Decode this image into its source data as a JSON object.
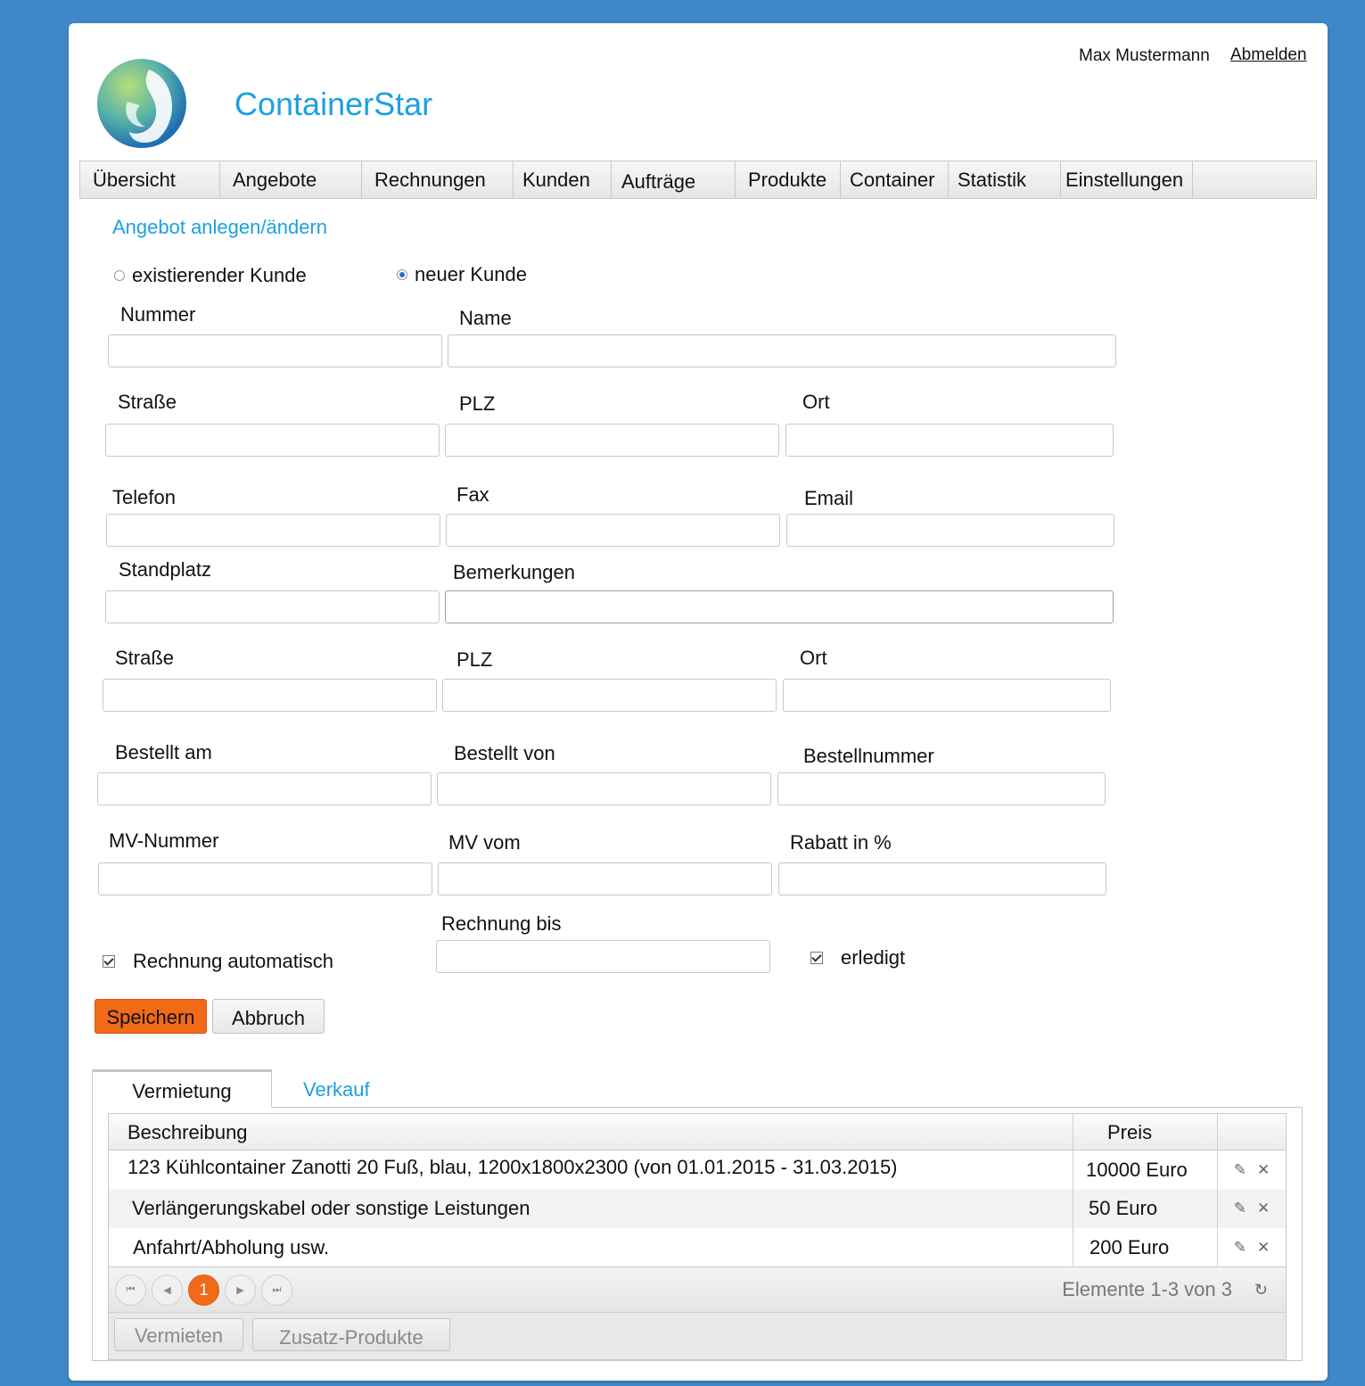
{
  "header": {
    "app_title": "ContainerStar",
    "user_name": "Max Mustermann",
    "logout_label": "Abmelden"
  },
  "nav": {
    "items": [
      {
        "label": "Übersicht"
      },
      {
        "label": "Angebote"
      },
      {
        "label": "Rechnungen"
      },
      {
        "label": "Kunden"
      },
      {
        "label": "Aufträge"
      },
      {
        "label": "Produkte"
      },
      {
        "label": "Container"
      },
      {
        "label": "Statistik"
      },
      {
        "label": "Einstellungen"
      }
    ]
  },
  "form": {
    "title": "Angebot anlegen/ändern",
    "customer_mode": {
      "existing_label": "existierender Kunde",
      "new_label": "neuer Kunde",
      "selected": "neuer Kunde"
    },
    "labels": {
      "nummer": "Nummer",
      "name": "Name",
      "strasse": "Straße",
      "plz": "PLZ",
      "ort": "Ort",
      "telefon": "Telefon",
      "fax": "Fax",
      "email": "Email",
      "standplatz": "Standplatz",
      "bemerkungen": "Bemerkungen",
      "strasse2": "Straße",
      "plz2": "PLZ",
      "ort2": "Ort",
      "bestellt_am": "Bestellt am",
      "bestellt_von": "Bestellt von",
      "bestellnummer": "Bestellnummer",
      "mv_nummer": "MV-Nummer",
      "mv_vom": "MV vom",
      "rabatt": "Rabatt in %",
      "rechnung_bis": "Rechnung bis"
    },
    "values": {
      "nummer": "",
      "name": "",
      "strasse": "",
      "plz": "",
      "ort": "",
      "telefon": "",
      "fax": "",
      "email": "",
      "standplatz": "",
      "bemerkungen": "",
      "strasse2": "",
      "plz2": "",
      "ort2": "",
      "bestellt_am": "",
      "bestellt_von": "",
      "bestellnummer": "",
      "mv_nummer": "",
      "mv_vom": "",
      "rabatt": "",
      "rechnung_bis": ""
    },
    "rechnung_automatisch": {
      "label": "Rechnung automatisch",
      "checked": true
    },
    "erledigt": {
      "label": "erledigt",
      "checked": true
    },
    "save_label": "Speichern",
    "cancel_label": "Abbruch"
  },
  "tabs": {
    "items": [
      {
        "label": "Vermietung",
        "active": true
      },
      {
        "label": "Verkauf",
        "active": false
      }
    ]
  },
  "grid": {
    "columns": [
      "Beschreibung",
      "Preis",
      ""
    ],
    "rows": [
      {
        "beschreibung": "123 Kühlcontainer Zanotti 20 Fuß, blau, 1200x1800x2300 (von 01.01.2015 - 31.03.2015)",
        "preis": "10000 Euro"
      },
      {
        "beschreibung": "Verlängerungskabel oder sonstige Leistungen",
        "preis": "50 Euro"
      },
      {
        "beschreibung": "Anfahrt/Abholung usw.",
        "preis": "200 Euro"
      }
    ],
    "pager": {
      "current_page": "1",
      "info": "Elemente 1-3 von 3"
    },
    "toolbar": {
      "rent_label": "Vermieten",
      "extra_label": "Zusatz-Produkte"
    }
  },
  "colors": {
    "background": "#3f87c6",
    "accent": "#1ca0e1",
    "primary_button": "#f06a1a"
  }
}
